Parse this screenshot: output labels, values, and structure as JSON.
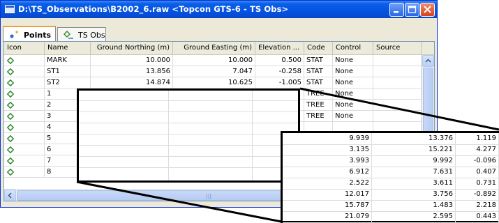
{
  "window": {
    "title": "D:\\TS_Observations\\B2002_6.raw  <Topcon GTS-6 - TS Obs>",
    "icon": "window-app-icon"
  },
  "titlebar_buttons": {
    "minimize": "minimize-icon",
    "maximize": "maximize-icon",
    "close": "close-icon"
  },
  "tabs": [
    {
      "label": "Points",
      "icon": "points-icon",
      "active": true
    },
    {
      "label": "TS Obs",
      "icon": "ts-obs-icon",
      "active": false
    }
  ],
  "columns": [
    "Icon",
    "Name",
    "Ground Northing (m)",
    "Ground Easting (m)",
    "Elevation ...",
    "Code",
    "Control",
    "Source"
  ],
  "rows": [
    {
      "name": "MARK",
      "northing": "10.000",
      "easting": "10.000",
      "elevation": "0.500",
      "code": "STAT",
      "control": "None",
      "source": ""
    },
    {
      "name": "ST1",
      "northing": "13.856",
      "easting": "7.047",
      "elevation": "-0.258",
      "code": "STAT",
      "control": "None",
      "source": ""
    },
    {
      "name": "ST2",
      "northing": "14.874",
      "easting": "10.625",
      "elevation": "-1.005",
      "code": "STAT",
      "control": "None",
      "source": ""
    },
    {
      "name": "1",
      "northing": "",
      "easting": "",
      "elevation": "",
      "code": "TREE",
      "control": "None",
      "source": ""
    },
    {
      "name": "2",
      "northing": "",
      "easting": "",
      "elevation": "",
      "code": "TREE",
      "control": "None",
      "source": ""
    },
    {
      "name": "3",
      "northing": "",
      "easting": "",
      "elevation": "",
      "code": "TREE",
      "control": "None",
      "source": ""
    },
    {
      "name": "4",
      "northing": "",
      "easting": "",
      "elevation": "",
      "code": "",
      "control": "",
      "source": ""
    },
    {
      "name": "5",
      "northing": "",
      "easting": "",
      "elevation": "",
      "code": "",
      "control": "",
      "source": ""
    },
    {
      "name": "6",
      "northing": "",
      "easting": "",
      "elevation": "",
      "code": "",
      "control": "",
      "source": ""
    },
    {
      "name": "7",
      "northing": "",
      "easting": "",
      "elevation": "",
      "code": "",
      "control": "",
      "source": ""
    },
    {
      "name": "8",
      "northing": "",
      "easting": "",
      "elevation": "",
      "code": "",
      "control": "",
      "source": ""
    }
  ],
  "callout_rows": [
    {
      "northing": "9.939",
      "easting": "13.376",
      "elevation": "1.119"
    },
    {
      "northing": "3.135",
      "easting": "15.221",
      "elevation": "4.277"
    },
    {
      "northing": "3.993",
      "easting": "9.992",
      "elevation": "-0.096"
    },
    {
      "northing": "6.912",
      "easting": "7.631",
      "elevation": "0.407"
    },
    {
      "northing": "2.522",
      "easting": "3.611",
      "elevation": "0.731"
    },
    {
      "northing": "12.017",
      "easting": "3.756",
      "elevation": "-0.892"
    },
    {
      "northing": "15.787",
      "easting": "1.483",
      "elevation": "2.218"
    },
    {
      "northing": "21.079",
      "easting": "2.595",
      "elevation": "0.443"
    }
  ],
  "colors": {
    "titlebar": "#0553e3",
    "point_icon": "#2e8b2e",
    "tab_accent": "#e8a33c"
  }
}
